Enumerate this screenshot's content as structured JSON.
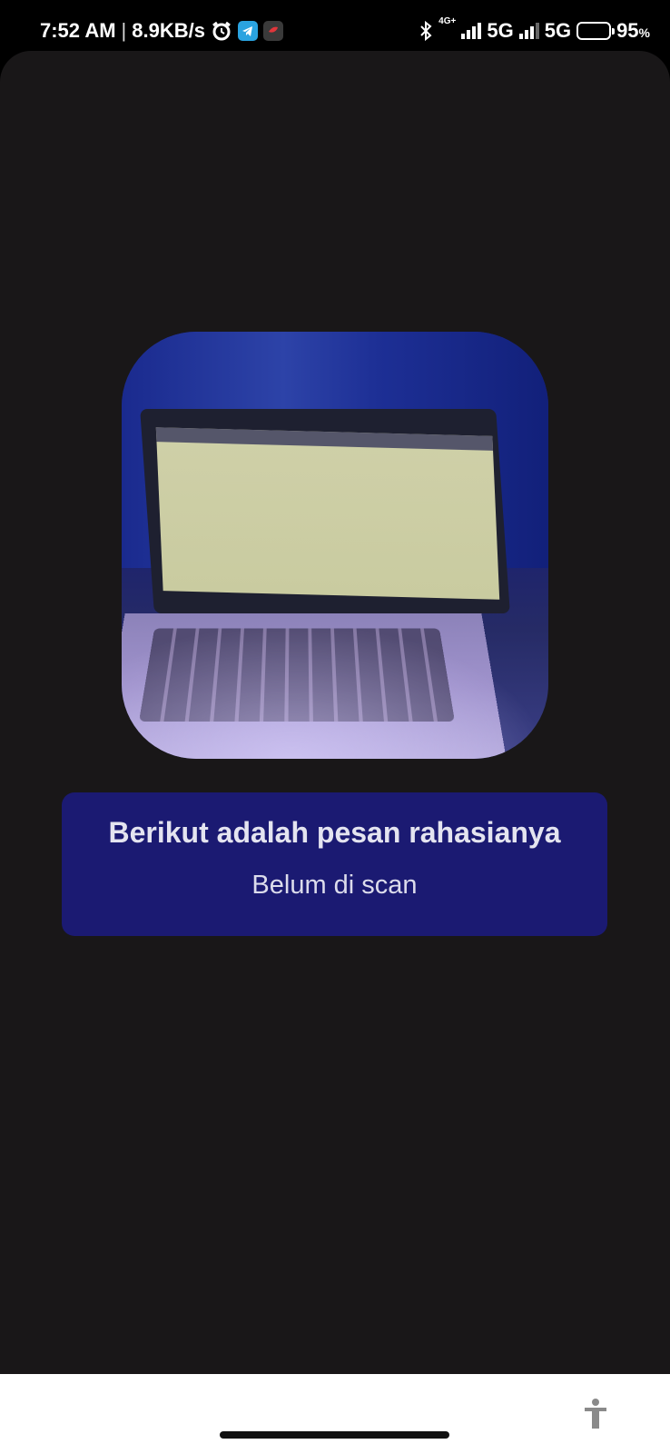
{
  "status_bar": {
    "time": "7:52 AM",
    "separator": "|",
    "net_speed": "8.9KB/s",
    "network_small": "4G+",
    "network1": "5G",
    "network2": "5G",
    "battery_value": "95",
    "battery_unit": "%",
    "icons": [
      "alarm-icon",
      "telegram-icon",
      "app-notification-icon",
      "bluetooth-icon",
      "signal-icon",
      "battery-icon"
    ]
  },
  "main": {
    "image_description_icon": "photo",
    "card": {
      "title": "Berikut adalah pesan rahasianya",
      "message": "Belum di scan"
    }
  },
  "navigation": {
    "accessibility_icon": "accessibility-icon"
  },
  "colors": {
    "app_background": "#191718",
    "card_background": "#1b1a72",
    "card_text": "#e4e4f0",
    "nav_background": "#ffffff"
  }
}
